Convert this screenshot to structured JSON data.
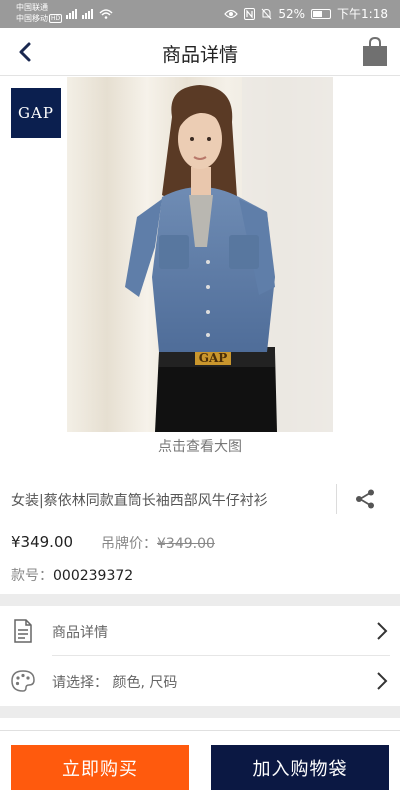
{
  "status_bar": {
    "carrier_1": "中国联通",
    "carrier_2": "中国移动",
    "hd_badge": "HD",
    "battery": "52%",
    "time": "下午1:18"
  },
  "nav": {
    "title": "商品详情",
    "back_icon": "chevron-left-icon",
    "bag_icon": "shopping-bag-icon"
  },
  "brand": {
    "logo_text": "GAP"
  },
  "image": {
    "view_large": "点击查看大图",
    "belt_text": "GAP"
  },
  "product": {
    "title": "女装|蔡依林同款直筒长袖西部风牛仔衬衫",
    "price": "¥349.00",
    "tag_price_label": "吊牌价：",
    "tag_price": "¥349.00",
    "style_no_label": "款号：",
    "style_no": "000239372"
  },
  "rows": {
    "details": "商品详情",
    "select": "请选择：  颜色, 尺码"
  },
  "actions": {
    "buy_now": "立即购买",
    "add_to_bag": "加入购物袋"
  },
  "colors": {
    "buy_button": "#ff5a0d",
    "cart_button": "#0b1843",
    "brand_logo": "#0b1f4f",
    "status_bar": "#9a9a9a"
  }
}
